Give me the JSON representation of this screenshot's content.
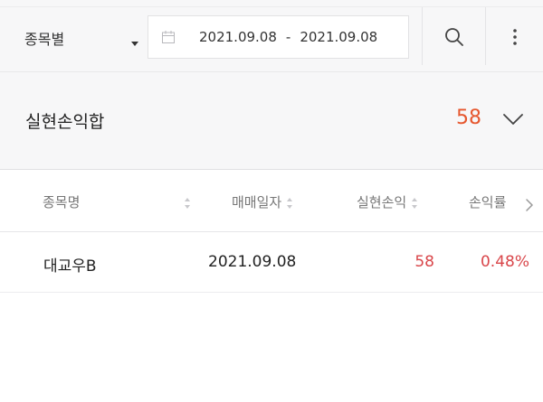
{
  "topbar": {
    "filter_label": "종목별",
    "date_start": "2021.09.08",
    "date_sep": "-",
    "date_end": "2021.09.08"
  },
  "summary": {
    "title": "실현손익합",
    "value": "58"
  },
  "table": {
    "headers": [
      "종목명",
      "매매일자",
      "실현손익",
      "손익률"
    ],
    "rows": [
      {
        "name": "대교우B",
        "date": "2021.09.08",
        "profit": "58",
        "rate": "0.48%"
      }
    ]
  },
  "icons": [
    "chevron-down-icon",
    "calendar-icon",
    "search-icon",
    "more-vertical-icon",
    "chevron-down-icon",
    "sort-icon",
    "chevron-right-icon"
  ],
  "colors": {
    "accent": "#e6572e",
    "gain": "#d9464a"
  }
}
